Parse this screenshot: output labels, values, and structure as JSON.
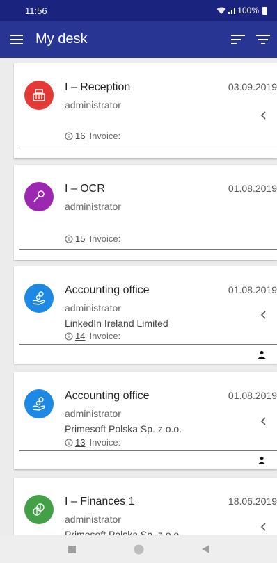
{
  "status": {
    "time": "11:56",
    "battery": "100%"
  },
  "appbar": {
    "title": "My desk"
  },
  "cards": [
    {
      "name": "I – Reception",
      "date": "03.09.2019",
      "user": "administrator",
      "company": "",
      "number": "16",
      "doc_type": "Invoice:",
      "color": "#e53935",
      "icon": "cash-register-icon",
      "has_chevron": true,
      "assigned": false
    },
    {
      "name": "I – OCR",
      "date": "01.08.2019",
      "user": "administrator",
      "company": "",
      "number": "15",
      "doc_type": "Invoice:",
      "color": "#9c27b0",
      "icon": "wand-icon",
      "has_chevron": false,
      "assigned": false
    },
    {
      "name": "Accounting office",
      "date": "01.08.2019",
      "user": "administrator",
      "company": "LinkedIn Ireland Limited",
      "number": "14",
      "doc_type": "Invoice:",
      "color": "#1e88e5",
      "icon": "hand-coins-icon",
      "has_chevron": true,
      "assigned": true
    },
    {
      "name": "Accounting office",
      "date": "01.08.2019",
      "user": "administrator",
      "company": "Primesoft Polska Sp. z o.o.",
      "number": "13",
      "doc_type": "Invoice:",
      "color": "#1e88e5",
      "icon": "hand-coins-icon",
      "has_chevron": true,
      "assigned": true
    },
    {
      "name": "I – Finances 1",
      "date": "18.06.2019",
      "user": "administrator",
      "company": "Primesoft Polska Sp. z o.o.",
      "number": "",
      "doc_type": "",
      "color": "#43a047",
      "icon": "money-icon",
      "has_chevron": true,
      "assigned": false
    }
  ]
}
